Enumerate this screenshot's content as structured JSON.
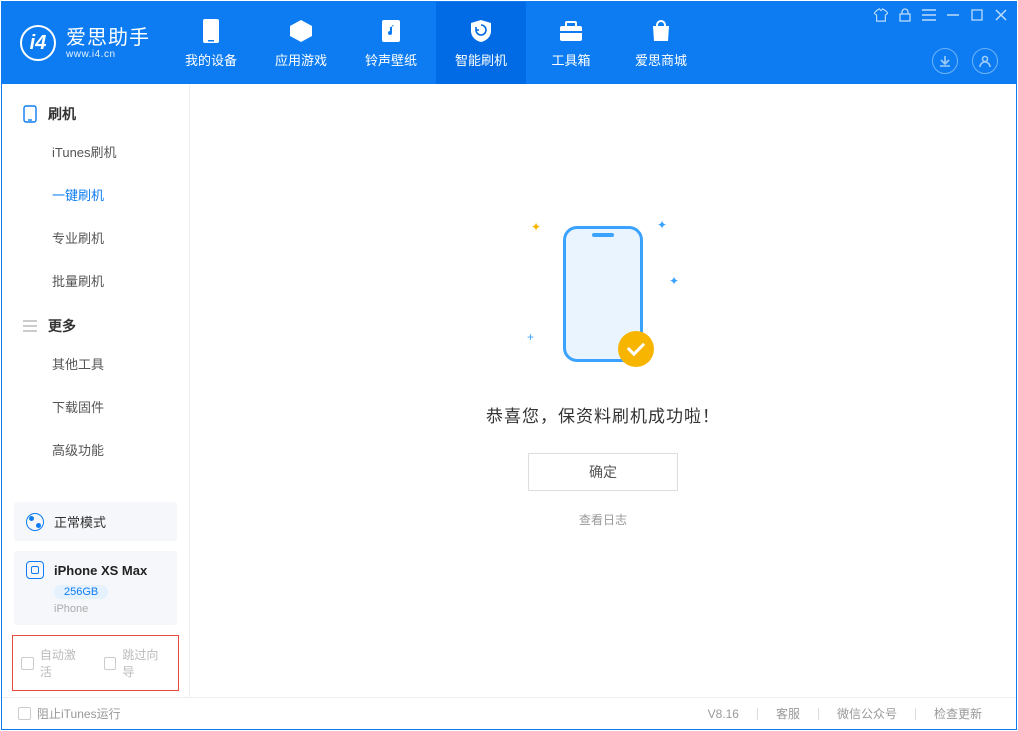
{
  "app": {
    "title": "爱思助手",
    "url": "www.i4.cn"
  },
  "tabs": {
    "t0": "我的设备",
    "t1": "应用游戏",
    "t2": "铃声壁纸",
    "t3": "智能刷机",
    "t4": "工具箱",
    "t5": "爱思商城"
  },
  "sidebar": {
    "group1": "刷机",
    "items": {
      "i0": "iTunes刷机",
      "i1": "一键刷机",
      "i2": "专业刷机",
      "i3": "批量刷机"
    },
    "group2": "更多",
    "more": {
      "m0": "其他工具",
      "m1": "下载固件",
      "m2": "高级功能"
    },
    "mode": "正常模式",
    "device": {
      "name": "iPhone XS Max",
      "capacity": "256GB",
      "type": "iPhone"
    },
    "checks": {
      "c0": "自动激活",
      "c1": "跳过向导"
    }
  },
  "main": {
    "success": "恭喜您，保资料刷机成功啦！",
    "ok": "确定",
    "log": "查看日志"
  },
  "footer": {
    "block_itunes": "阻止iTunes运行",
    "version": "V8.16",
    "links": {
      "l0": "客服",
      "l1": "微信公众号",
      "l2": "检查更新"
    }
  }
}
